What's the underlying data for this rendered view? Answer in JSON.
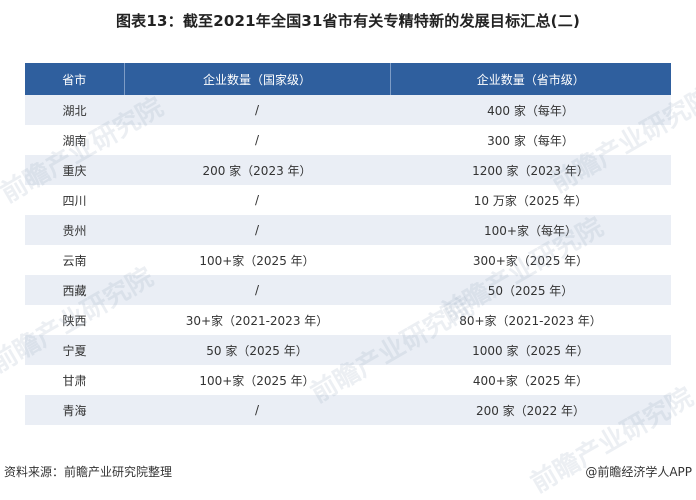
{
  "title": "图表13：截至2021年全国31省市有关专精特新的发展目标汇总(二)",
  "table": {
    "headers": [
      "省市",
      "企业数量（国家级）",
      "企业数量（省市级）"
    ],
    "rows": [
      [
        "湖北",
        "/",
        "400 家（每年）"
      ],
      [
        "湖南",
        "/",
        "300 家（每年）"
      ],
      [
        "重庆",
        "200 家（2023 年）",
        "1200 家（2023 年）"
      ],
      [
        "四川",
        "/",
        "10 万家（2025 年）"
      ],
      [
        "贵州",
        "/",
        "100+家（每年）"
      ],
      [
        "云南",
        "100+家（2025 年）",
        "300+家（2025 年）"
      ],
      [
        "西藏",
        "/",
        "50（2025 年）"
      ],
      [
        "陕西",
        "30+家（2021-2023 年）",
        "80+家（2021-2023 年）"
      ],
      [
        "宁夏",
        "50 家（2025 年）",
        "1000 家（2025 年）"
      ],
      [
        "甘肃",
        "100+家（2025 年）",
        "400+家（2025 年）"
      ],
      [
        "青海",
        "/",
        "200 家（2022 年）"
      ]
    ]
  },
  "footer": {
    "source": "资料来源：前瞻产业研究院整理",
    "credit": "@前瞻经济学人APP"
  },
  "watermark": "前瞻产业研究院",
  "colors": {
    "header_bg": "#2f5f9e",
    "row_alt_bg": "#eaeef5"
  }
}
